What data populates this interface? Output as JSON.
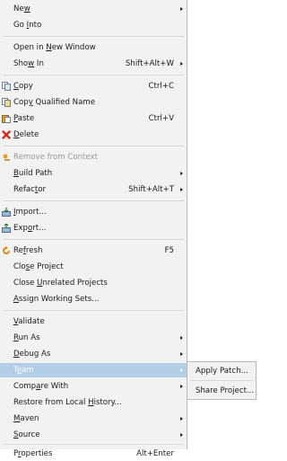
{
  "menu": {
    "new": {
      "pre": "Ne",
      "key": "w",
      "post": ""
    },
    "go_into": {
      "pre": "Go ",
      "key": "I",
      "post": "nto"
    },
    "open_new_window": {
      "pre": "Open in ",
      "key": "N",
      "post": "ew Window"
    },
    "show_in": {
      "pre": "Sho",
      "key": "w",
      "post": " In",
      "shortcut": "Shift+Alt+W"
    },
    "copy": {
      "pre": "",
      "key": "C",
      "post": "opy",
      "shortcut": "Ctrl+C"
    },
    "copy_qualified": {
      "pre": "Cop",
      "key": "y",
      "post": " Qualified Name"
    },
    "paste": {
      "pre": "",
      "key": "P",
      "post": "aste",
      "shortcut": "Ctrl+V"
    },
    "delete": {
      "pre": "",
      "key": "D",
      "post": "elete"
    },
    "remove_context": {
      "label": "Remove from Context"
    },
    "build_path": {
      "pre": "",
      "key": "B",
      "post": "uild Path"
    },
    "refactor": {
      "pre": "Refac",
      "key": "t",
      "post": "or",
      "shortcut": "Shift+Alt+T"
    },
    "import": {
      "pre": "",
      "key": "I",
      "post": "mport..."
    },
    "export": {
      "pre": "Exp",
      "key": "o",
      "post": "rt..."
    },
    "refresh": {
      "pre": "Re",
      "key": "f",
      "post": "resh",
      "shortcut": "F5"
    },
    "close_project": {
      "pre": "Clo",
      "key": "s",
      "post": "e Project"
    },
    "close_unrelated": {
      "pre": "Close ",
      "key": "U",
      "post": "nrelated Projects"
    },
    "assign_sets": {
      "pre": "",
      "key": "A",
      "post": "ssign Working Sets..."
    },
    "validate": {
      "pre": "",
      "key": "V",
      "post": "alidate"
    },
    "run_as": {
      "pre": "",
      "key": "R",
      "post": "un As"
    },
    "debug_as": {
      "pre": "",
      "key": "D",
      "post": "ebug As"
    },
    "team": {
      "pre": "T",
      "key": "e",
      "post": "am"
    },
    "compare_with": {
      "pre": "Comp",
      "key": "a",
      "post": "re With"
    },
    "restore_history": {
      "pre": "Restore from Local ",
      "key": "H",
      "post": "istory..."
    },
    "maven": {
      "pre": "",
      "key": "M",
      "post": "aven"
    },
    "source": {
      "pre": "",
      "key": "S",
      "post": "ource"
    },
    "properties": {
      "pre": "P",
      "key": "r",
      "post": "operties",
      "shortcut": "Alt+Enter"
    }
  },
  "submenu": {
    "apply_patch": "Apply Patch...",
    "share_project": "Share Project..."
  },
  "colors": {
    "highlight": "#b4cde7",
    "menu_bg": "#f2f2f2",
    "disabled_text": "#9a9a9a"
  },
  "icons": {
    "copy": "copy-icon",
    "copy_qualified": "copy-qualified-name-icon",
    "paste": "paste-icon",
    "delete": "delete-red-x-icon",
    "remove_context": "remove-context-icon",
    "import": "import-icon",
    "export": "export-icon",
    "refresh": "refresh-icon"
  }
}
